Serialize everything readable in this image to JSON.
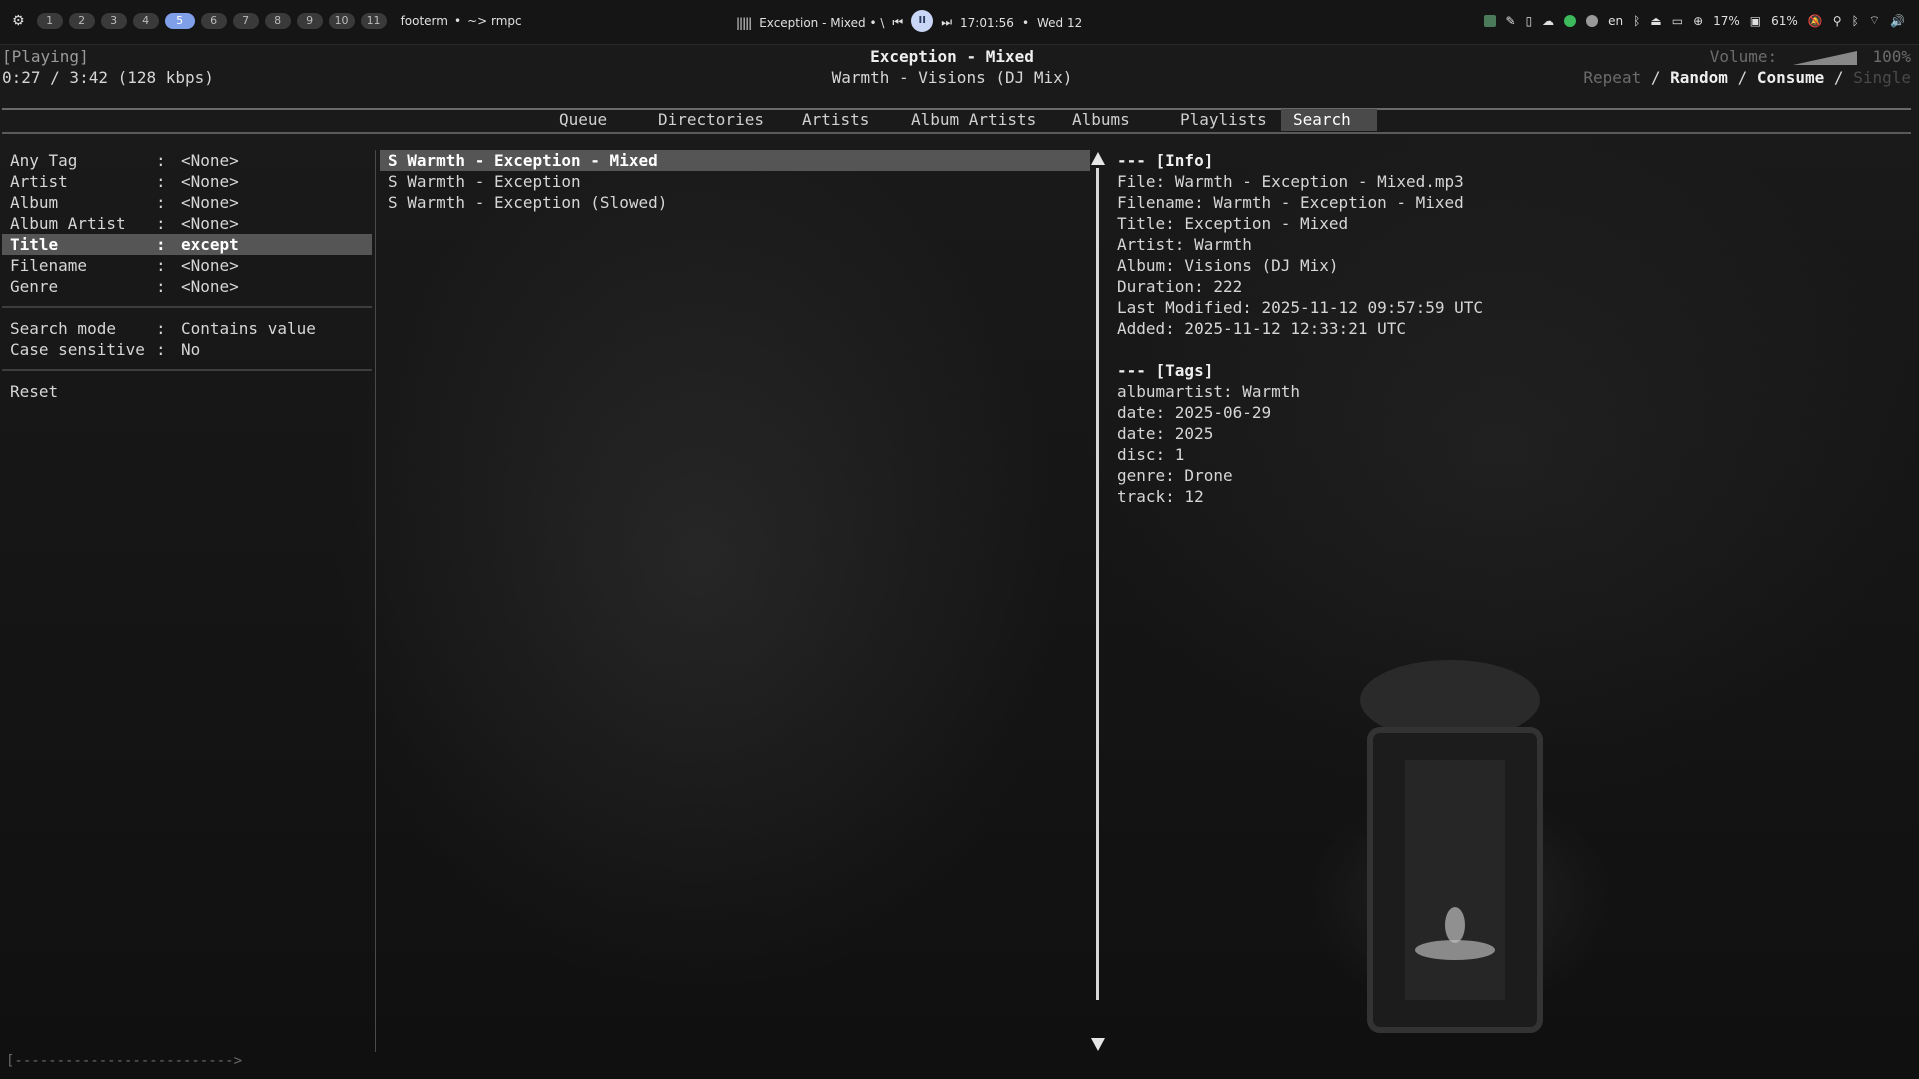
{
  "topbar": {
    "workspaces": [
      "1",
      "2",
      "3",
      "4",
      "5",
      "6",
      "7",
      "8",
      "9",
      "10",
      "11"
    ],
    "active_workspace": "5",
    "terminal": "footerm",
    "dot": "•",
    "prompt": "~> rmpc",
    "now_playing": "Exception - Mixed • \\",
    "pause": "II",
    "time": "17:01:56",
    "date": "Wed 12",
    "lang": "en",
    "cpu": "17%",
    "battery": "61%"
  },
  "header": {
    "state": "[Playing]",
    "progress": "0:27 / 3:42 (128 kbps)",
    "title": "Exception - Mixed",
    "subtitle": "Warmth - Visions (DJ Mix)",
    "volume_label": "Volume:",
    "volume_value": "100%",
    "volume_level": 1.0,
    "modes": {
      "repeat": "Repeat",
      "random": "Random",
      "consume": "Consume",
      "single": "Single",
      "slash": "/"
    }
  },
  "tabs": [
    "Queue",
    "Directories",
    "Artists",
    "Album Artists",
    "Albums",
    "Playlists",
    "Search"
  ],
  "active_tab": "Search",
  "search": {
    "fields": [
      {
        "label": "Any Tag",
        "colon": ":",
        "value": "<None>"
      },
      {
        "label": "Artist",
        "colon": ":",
        "value": "<None>"
      },
      {
        "label": "Album",
        "colon": ":",
        "value": "<None>"
      },
      {
        "label": "Album Artist",
        "colon": ":",
        "value": "<None>"
      },
      {
        "label": "Title",
        "colon": ":",
        "value": "except"
      },
      {
        "label": "Filename",
        "colon": ":",
        "value": "<None>"
      },
      {
        "label": "Genre",
        "colon": ":",
        "value": "<None>"
      }
    ],
    "options": [
      {
        "label": "Search mode",
        "colon": ":",
        "value": "Contains value"
      },
      {
        "label": "Case sensitive",
        "colon": ":",
        "value": "No"
      }
    ],
    "reset": "Reset"
  },
  "results": [
    "S Warmth - Exception - Mixed",
    "S Warmth - Exception",
    "S Warmth - Exception (Slowed)"
  ],
  "info": {
    "info_header": "--- [Info]",
    "lines": [
      "File: Warmth - Exception - Mixed.mp3",
      "Filename: Warmth - Exception - Mixed",
      "Title: Exception - Mixed",
      "Artist: Warmth",
      "Album: Visions (DJ Mix)",
      "Duration: 222",
      "Last Modified: 2025-11-12 09:57:59 UTC",
      "Added: 2025-11-12 12:33:21 UTC"
    ],
    "tags_header": "--- [Tags]",
    "tags": [
      "albumartist: Warmth",
      "date: 2025-06-29",
      "date: 2025",
      "disc: 1",
      "genre: Drone",
      "track: 12"
    ]
  },
  "status_line": "[-------------------------->"
}
